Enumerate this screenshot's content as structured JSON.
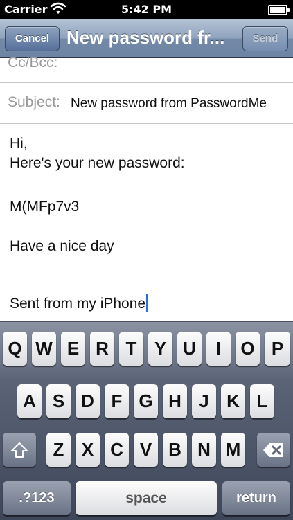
{
  "status_bar": {
    "carrier": "Carrier",
    "time": "5:42 PM",
    "icons": [
      "wifi-icon",
      "battery-icon"
    ]
  },
  "nav": {
    "cancel": "Cancel",
    "title": "New password fr...",
    "send": "Send"
  },
  "fields": {
    "cc_label": "Cc/Bcc:",
    "subject_label": "Subject:",
    "subject_value": "New password from PasswordMe"
  },
  "body": {
    "line1": "Hi,",
    "line2": "Here's your new password:",
    "line3": "",
    "password": "M(MFp7v3",
    "line5": "",
    "line6": "Have a nice day",
    "signature": "Sent from my iPhone"
  },
  "keyboard": {
    "row1": [
      "Q",
      "W",
      "E",
      "R",
      "T",
      "Y",
      "U",
      "I",
      "O",
      "P"
    ],
    "row2": [
      "A",
      "S",
      "D",
      "F",
      "G",
      "H",
      "J",
      "K",
      "L"
    ],
    "row3": [
      "Z",
      "X",
      "C",
      "V",
      "B",
      "N",
      "M"
    ],
    "numbers_key": ".?123",
    "space_key": "space",
    "return_key": "return",
    "shift_icon": "shift-icon",
    "delete_icon": "delete-icon"
  }
}
